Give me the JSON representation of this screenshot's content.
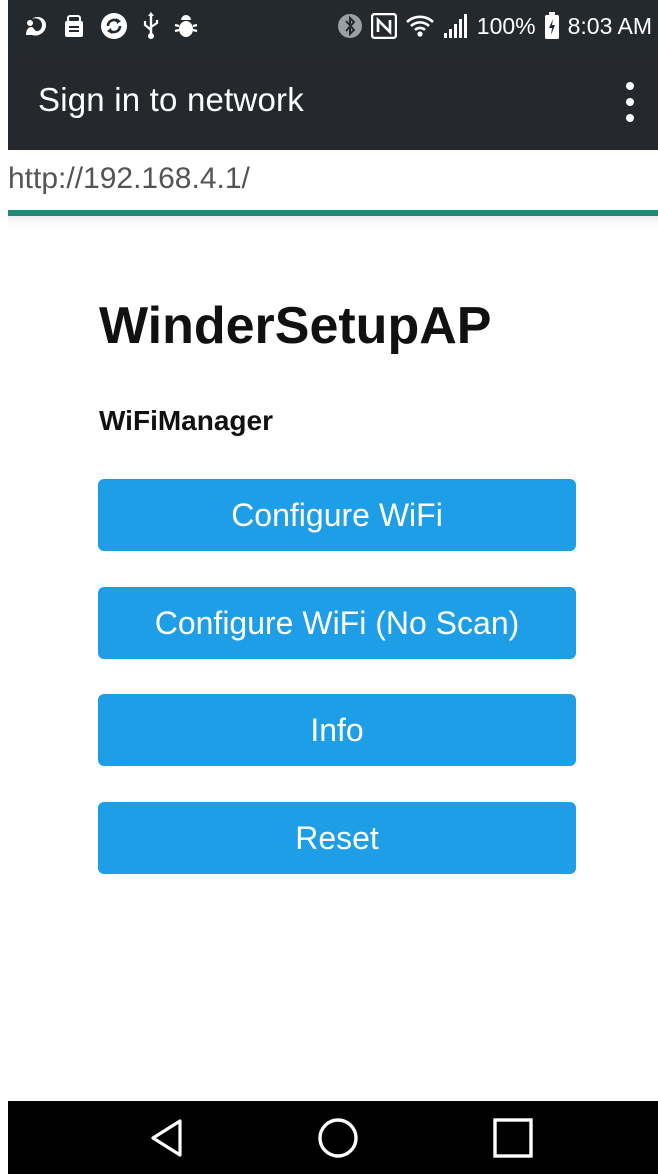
{
  "status_bar": {
    "battery_percent_label": "100%",
    "time": "8:03 AM",
    "left_icons": [
      "notification-squirrel-icon",
      "notification-box-icon",
      "sync-icon",
      "usb-icon",
      "bug-icon"
    ],
    "right_icons": [
      "bluetooth-icon",
      "nfc-icon",
      "wifi-icon",
      "signal-icon",
      "battery-icon"
    ]
  },
  "toolbar": {
    "title": "Sign in to network",
    "menu_icon": "overflow-menu-icon"
  },
  "url_bar": {
    "url": "http://192.168.4.1/"
  },
  "page": {
    "title": "WinderSetupAP",
    "subtitle": "WiFiManager",
    "buttons": [
      {
        "label": "Configure WiFi"
      },
      {
        "label": "Configure WiFi (No Scan)"
      },
      {
        "label": "Info"
      },
      {
        "label": "Reset"
      }
    ],
    "button_color": "#1e9ee6"
  },
  "nav_bar": {
    "icons": [
      "back-icon",
      "home-icon",
      "recents-icon"
    ]
  }
}
